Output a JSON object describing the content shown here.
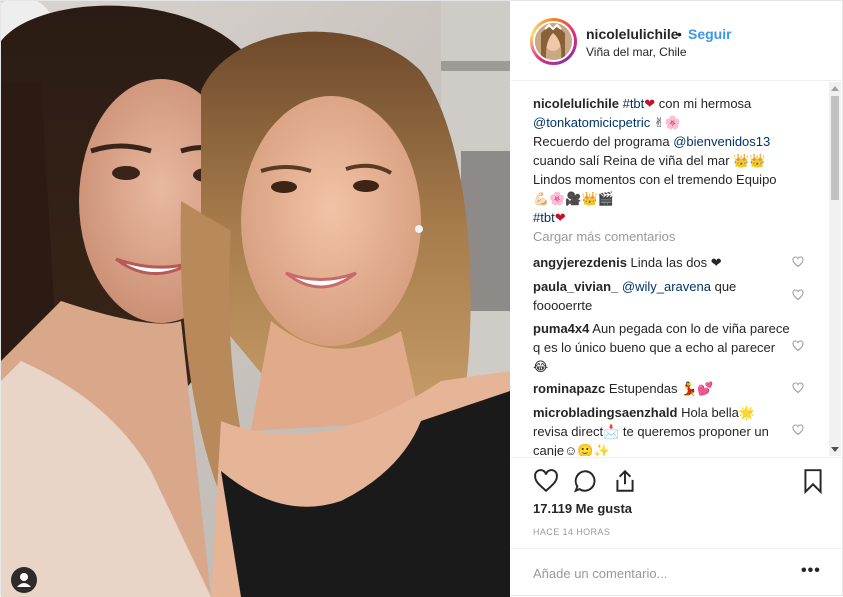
{
  "post": {
    "username": "nicolelulichile",
    "follow_label": "Seguir",
    "separator": "•",
    "location": "Viña del mar, Chile"
  },
  "caption": {
    "username": "nicolelulichile",
    "tag1": "#tbt",
    "emoji1": "❤",
    "text1": " con mi hermosa",
    "mention1": "@tonkatomicicpetric",
    "emoji2": " ✌🌸",
    "text2": "Recuerdo del programa ",
    "mention2": "@bienvenidos13",
    "text3": "cuando salí Reina de viña del mar 👑👑",
    "text4": "Lindos momentos con el tremendo Equipo",
    "emoji3": "💪🏻🌸🎥👑🎬",
    "tag2": "#tbt",
    "emoji4": "❤"
  },
  "load_more_label": "Cargar más comentarios",
  "comments": [
    {
      "user": "angyjerezdenis",
      "text": " Linda las dos ❤"
    },
    {
      "user": "paula_vivian_",
      "mention": "@wily_aravena",
      "text": " que fooooerrte"
    },
    {
      "user": "puma4x4",
      "text": " Aun pegada con lo de viña parece q es lo único bueno que a echo al parecer 😂"
    },
    {
      "user": "rominapazc",
      "text": " Estupendas 💃💕"
    },
    {
      "user": "microbladingsaenzhald",
      "text": " Hola bella🌟 revisa direct📩 te queremos proponer un canje☺🙂✨"
    }
  ],
  "likes": "17.119 Me gusta",
  "timestamp": "HACE 14 HORAS",
  "add_comment_placeholder": "Añade un comentario...",
  "more_options": "•••",
  "icons": {
    "like": "heart-icon",
    "comment": "comment-icon",
    "share": "share-icon",
    "save": "bookmark-icon",
    "tagged": "user-tag-icon"
  },
  "colors": {
    "link": "#3897f0",
    "mention": "#003569",
    "muted": "#999999",
    "text": "#262626"
  }
}
